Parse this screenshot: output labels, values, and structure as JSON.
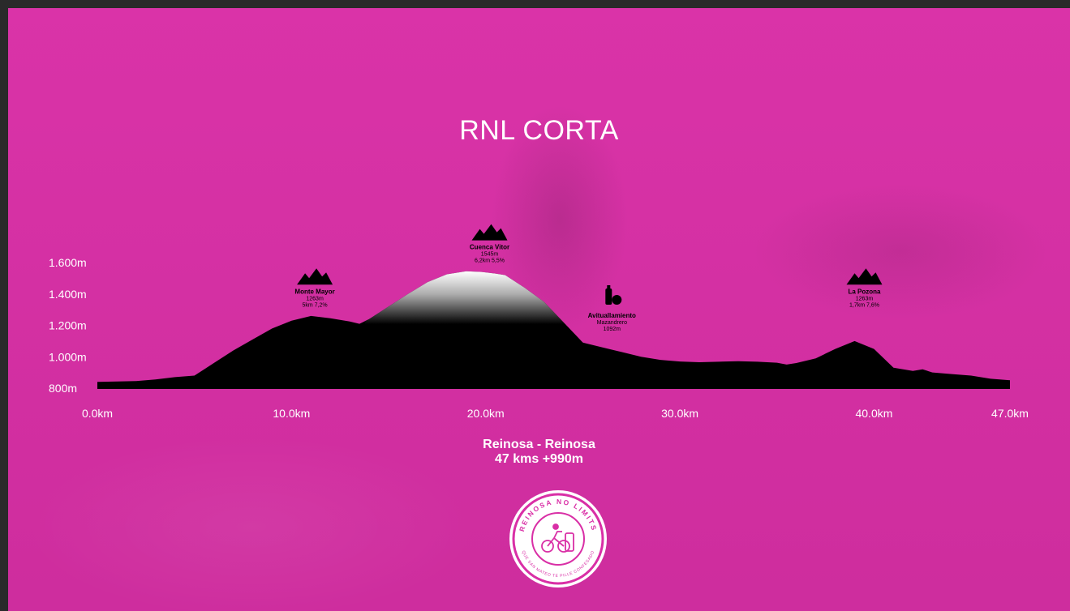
{
  "title": "RNL CORTA",
  "route": {
    "name": "Reinosa - Reinosa",
    "summary": "47 kms +990m"
  },
  "colors": {
    "background": "#d92fa6",
    "profile": "#000000",
    "text": "#ffffff"
  },
  "logo": {
    "top_text": "REINOSA NO LIMITS",
    "bottom_text": "QUE SAN MATEO TE PILLE CONFESADO"
  },
  "chart_data": {
    "type": "area",
    "title": "",
    "xlabel": "",
    "ylabel": "",
    "xlim": [
      0,
      47
    ],
    "ylim": [
      800,
      1600
    ],
    "x_ticks": [
      0,
      10,
      20,
      30,
      40,
      47
    ],
    "x_tick_labels": [
      "0.0km",
      "10.0km",
      "20.0km",
      "30.0km",
      "40.0km",
      "47.0km"
    ],
    "y_ticks": [
      800,
      1000,
      1200,
      1400,
      1600
    ],
    "y_tick_labels": [
      "800m",
      "1.000m",
      "1.200m",
      "1.400m",
      "1.600m"
    ],
    "grid": false,
    "series": [
      {
        "x": [
          0,
          2,
          3,
          4,
          5,
          6,
          7,
          8,
          9,
          10,
          11,
          12,
          13,
          13.5,
          14,
          15,
          16,
          17,
          18,
          19,
          19.8,
          20.5,
          21,
          22,
          23,
          24,
          25,
          26,
          27,
          28,
          29,
          30,
          31,
          32,
          33,
          34,
          35,
          35.5,
          36,
          37,
          38,
          39,
          40,
          41,
          42,
          42.5,
          43,
          44,
          45,
          46,
          47
        ],
        "y": [
          840,
          845,
          855,
          870,
          880,
          960,
          1040,
          1110,
          1180,
          1230,
          1260,
          1245,
          1225,
          1210,
          1240,
          1320,
          1400,
          1475,
          1525,
          1545,
          1540,
          1530,
          1520,
          1440,
          1350,
          1220,
          1090,
          1060,
          1030,
          1000,
          980,
          970,
          965,
          968,
          972,
          968,
          962,
          950,
          960,
          990,
          1050,
          1100,
          1050,
          930,
          910,
          920,
          900,
          890,
          880,
          860,
          850
        ]
      }
    ],
    "annotations": [
      {
        "icon": "mountain-icon",
        "name": "Monte Mayor",
        "elevation": "1263m",
        "detail": "5km 7,2%",
        "x": 11.2,
        "y": 1263
      },
      {
        "icon": "mountain-icon",
        "name": "Cuenca Vitor",
        "elevation": "1545m",
        "detail": "6,2km 5,5%",
        "x": 20.2,
        "y": 1545
      },
      {
        "icon": "feed-station-icon",
        "name": "Avituallamiento",
        "elevation": "Mazandrero",
        "detail": "1092m",
        "x": 26.5,
        "y": 1092
      },
      {
        "icon": "mountain-icon",
        "name": "La Pozona",
        "elevation": "1263m",
        "detail": "1,7km 7,6%",
        "x": 39.5,
        "y": 1263
      }
    ]
  }
}
